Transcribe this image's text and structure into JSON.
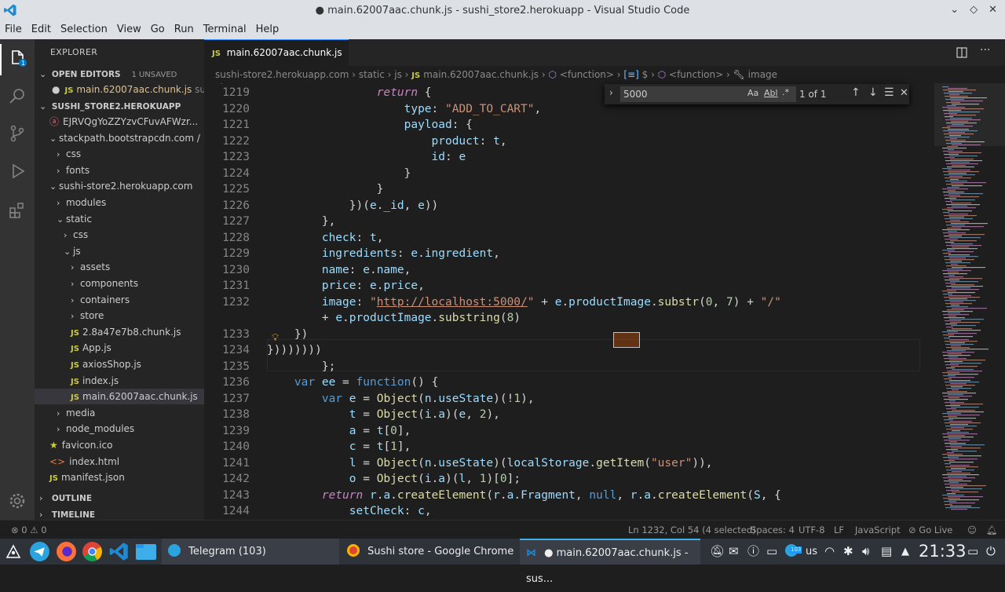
{
  "window_title": "● main.62007aac.chunk.js - sushi_store2.herokuapp - Visual Studio Code",
  "menu": [
    "File",
    "Edit",
    "Selection",
    "View",
    "Go",
    "Run",
    "Terminal",
    "Help"
  ],
  "sidebar": {
    "title": "EXPLORER",
    "open_editors_label": "OPEN EDITORS",
    "unsaved_badge": "1 UNSAVED",
    "open_file": "main.62007aac.chunk.js",
    "open_file_suffix": "su...",
    "project_label": "SUSHI_STORE2.HEROKUAPP",
    "tree": [
      {
        "label": "EJRVQgYoZZYzvCFuvAFWzr...",
        "indent": 1,
        "type": "cut"
      },
      {
        "label": "stackpath.bootstrapcdn.com / ...",
        "indent": 1,
        "type": "folder-open"
      },
      {
        "label": "css",
        "indent": 2,
        "type": "folder"
      },
      {
        "label": "fonts",
        "indent": 2,
        "type": "folder"
      },
      {
        "label": "sushi-store2.herokuapp.com",
        "indent": 1,
        "type": "folder-open"
      },
      {
        "label": "modules",
        "indent": 2,
        "type": "folder"
      },
      {
        "label": "static",
        "indent": 2,
        "type": "folder-open"
      },
      {
        "label": "css",
        "indent": 3,
        "type": "folder"
      },
      {
        "label": "js",
        "indent": 3,
        "type": "folder-open"
      },
      {
        "label": "assets",
        "indent": 4,
        "type": "folder"
      },
      {
        "label": "components",
        "indent": 4,
        "type": "folder"
      },
      {
        "label": "containers",
        "indent": 4,
        "type": "folder"
      },
      {
        "label": "store",
        "indent": 4,
        "type": "folder"
      },
      {
        "label": "2.8a47e7b8.chunk.js",
        "indent": 4,
        "type": "js"
      },
      {
        "label": "App.js",
        "indent": 4,
        "type": "js"
      },
      {
        "label": "axiosShop.js",
        "indent": 4,
        "type": "js"
      },
      {
        "label": "index.js",
        "indent": 4,
        "type": "js"
      },
      {
        "label": "main.62007aac.chunk.js",
        "indent": 4,
        "type": "js-selected"
      },
      {
        "label": "media",
        "indent": 2,
        "type": "folder"
      },
      {
        "label": "node_modules",
        "indent": 2,
        "type": "folder"
      },
      {
        "label": "favicon.ico",
        "indent": 1,
        "type": "star"
      },
      {
        "label": "index.html",
        "indent": 1,
        "type": "html"
      },
      {
        "label": "manifest.json",
        "indent": 1,
        "type": "json"
      }
    ],
    "outline_label": "OUTLINE",
    "timeline_label": "TIMELINE"
  },
  "tab": {
    "label": "main.62007aac.chunk.js",
    "js_badge": "JS"
  },
  "breadcrumbs": [
    "sushi-store2.herokuapp.com",
    "static",
    "js",
    "main.62007aac.chunk.js",
    "<function>",
    "$",
    "<function>",
    "image"
  ],
  "find": {
    "value": "5000",
    "opt_case": "Aa",
    "opt_word": "Abl",
    "opt_regex": ".*",
    "result": "1 of 1"
  },
  "code_lines": [
    {
      "n": "1219",
      "html": "                <span class='kw'>return</span> {"
    },
    {
      "n": "1220",
      "html": "                    <span class='id'>type</span>: <span class='str'>\"ADD_TO_CART\"</span>,"
    },
    {
      "n": "1221",
      "html": "                    <span class='id'>payload</span>: {"
    },
    {
      "n": "1222",
      "html": "                        <span class='id'>product</span>: <span class='id'>t</span>,"
    },
    {
      "n": "1223",
      "html": "                        <span class='id'>id</span>: <span class='id'>e</span>"
    },
    {
      "n": "1224",
      "html": "                    }"
    },
    {
      "n": "1225",
      "html": "                }"
    },
    {
      "n": "1226",
      "html": "            })(<span class='id'>e</span>.<span class='id'>_id</span>, <span class='id'>e</span>))"
    },
    {
      "n": "1227",
      "html": "        },"
    },
    {
      "n": "1228",
      "html": "        <span class='id'>check</span>: <span class='id'>t</span>,"
    },
    {
      "n": "1229",
      "html": "        <span class='id'>ingredients</span>: <span class='id'>e</span>.<span class='id'>ingredient</span>,"
    },
    {
      "n": "1230",
      "html": "        <span class='id'>name</span>: <span class='id'>e</span>.<span class='id'>name</span>,"
    },
    {
      "n": "1231",
      "html": "        <span class='id'>price</span>: <span class='id'>e</span>.<span class='id'>price</span>,"
    },
    {
      "n": "1232",
      "html": "        <span class='id'>image</span>: <span class='str'>\"</span><span class='url'>http://localhost:5000/</span><span class='str'>\"</span> + <span class='id'>e</span>.<span class='id'>productImage</span>.<span class='fn'>substr</span>(<span class='num'>0</span>, <span class='num'>7</span>) + <span class='str'>\"/\"</span>"
    },
    {
      "n": "",
      "html": "        + <span class='id'>e</span>.<span class='id'>productImage</span>.<span class='fn'>substring</span>(<span class='num'>8</span>)"
    },
    {
      "n": "1233",
      "html": "    })"
    },
    {
      "n": "1234",
      "html": "})))))))"
    },
    {
      "n": "1235",
      "html": "        };"
    },
    {
      "n": "1236",
      "html": "    <span class='kv'>var</span> <span class='id'>ee</span> = <span class='kv'>function</span>() {"
    },
    {
      "n": "1237",
      "html": "        <span class='kv'>var</span> <span class='id'>e</span> = <span class='fn'>Object</span>(<span class='id'>n</span>.<span class='id'>useState</span>)(!<span class='num'>1</span>),"
    },
    {
      "n": "1238",
      "html": "            <span class='id'>t</span> = <span class='fn'>Object</span>(<span class='id'>i</span>.<span class='id'>a</span>)(<span class='id'>e</span>, <span class='num'>2</span>),"
    },
    {
      "n": "1239",
      "html": "            <span class='id'>a</span> = <span class='id'>t</span>[<span class='num'>0</span>],"
    },
    {
      "n": "1240",
      "html": "            <span class='id'>c</span> = <span class='id'>t</span>[<span class='num'>1</span>],"
    },
    {
      "n": "1241",
      "html": "            <span class='id'>l</span> = <span class='fn'>Object</span>(<span class='id'>n</span>.<span class='id'>useState</span>)(<span class='id'>localStorage</span>.<span class='fn'>getItem</span>(<span class='str'>\"user\"</span>)),"
    },
    {
      "n": "1242",
      "html": "            <span class='id'>o</span> = <span class='fn'>Object</span>(<span class='id'>i</span>.<span class='id'>a</span>)(<span class='id'>l</span>, <span class='num'>1</span>)[<span class='num'>0</span>];"
    },
    {
      "n": "1243",
      "html": "        <span class='kw'>return</span> <span class='id'>r</span>.<span class='id'>a</span>.<span class='fn'>createElement</span>(<span class='id'>r</span>.<span class='id'>a</span>.<span class='id'>Fragment</span>, <span class='kv'>null</span>, <span class='id'>r</span>.<span class='id'>a</span>.<span class='fn'>createElement</span>(<span class='id'>S</span>, {"
    },
    {
      "n": "1244",
      "html": "            <span class='id'>setCheck</span>: <span class='id'>c</span>,"
    }
  ],
  "status": {
    "errors": "0",
    "warnings": "0",
    "position": "Ln 1232, Col 54 (4 selected)",
    "spaces": "Spaces: 4",
    "encoding": "UTF-8",
    "eol": "LF",
    "language": "JavaScript",
    "golive": "Go Live"
  },
  "taskbar": {
    "telegram": "Telegram (103)",
    "chrome": "Sushi store - Google Chrome",
    "vscode": "● main.62007aac.chunk.js - sus...",
    "lang": "us",
    "clock": "21:33",
    "badge": "103"
  },
  "colors": {
    "accent": "#3794ff",
    "unsaved": "#007acc"
  }
}
